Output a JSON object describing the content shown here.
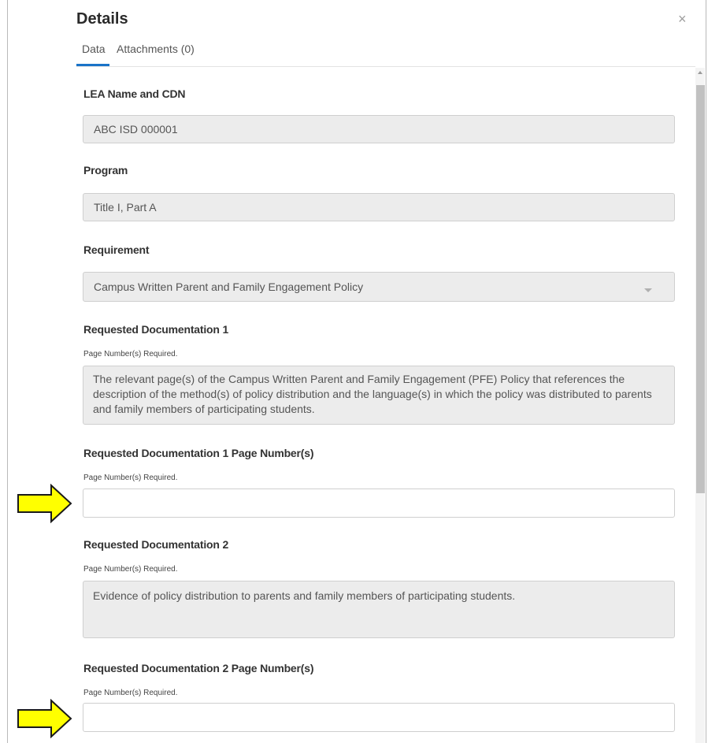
{
  "dialog": {
    "title": "Details",
    "close_symbol": "×",
    "tabs": [
      {
        "label": "Data",
        "active": true
      },
      {
        "label": "Attachments (0)",
        "active": false
      }
    ]
  },
  "colors": {
    "accent": "#1a73c8",
    "readonly_bg": "#ececec",
    "arrow_fill": "#ffff00"
  },
  "fields": {
    "lea_name": {
      "label": "LEA Name and CDN",
      "value": "ABC ISD  000001"
    },
    "program": {
      "label": "Program",
      "value": "Title I, Part A"
    },
    "requirement": {
      "label": "Requirement",
      "value": "Campus Written Parent and Family Engagement Policy"
    },
    "req_doc_1": {
      "label": "Requested Documentation 1",
      "hint": "Page Number(s) Required.",
      "value": "The relevant page(s) of the Campus Written Parent and Family Engagement (PFE) Policy that references the description of the method(s) of policy distribution and the language(s) in which the policy was distributed to parents and family members of participating students."
    },
    "req_doc_1_pages": {
      "label": "Requested Documentation 1 Page Number(s)",
      "hint": "Page Number(s) Required.",
      "value": ""
    },
    "req_doc_2": {
      "label": "Requested Documentation 2",
      "hint": "Page Number(s) Required.",
      "value": "Evidence of policy distribution to parents and family members of participating students."
    },
    "req_doc_2_pages": {
      "label": "Requested Documentation 2 Page Number(s)",
      "hint": "Page Number(s) Required.",
      "value": ""
    }
  }
}
